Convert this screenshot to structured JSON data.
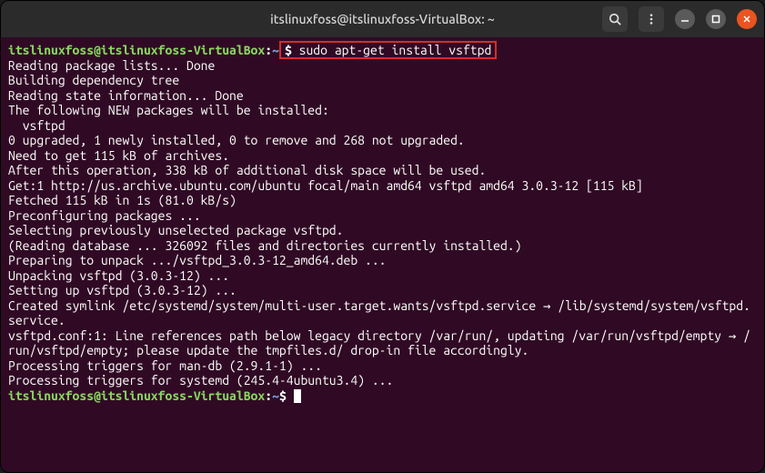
{
  "titlebar": {
    "title": "itslinuxfoss@itslinuxfoss-VirtualBox: ~"
  },
  "prompt": {
    "user_host": "itslinuxfoss@itslinuxfoss-VirtualBox",
    "colon": ":",
    "path": "~",
    "dollar": "$ "
  },
  "command": "sudo apt-get install vsftpd",
  "output": [
    "Reading package lists... Done",
    "Building dependency tree",
    "Reading state information... Done",
    "The following NEW packages will be installed:",
    "  vsftpd",
    "0 upgraded, 1 newly installed, 0 to remove and 268 not upgraded.",
    "Need to get 115 kB of archives.",
    "After this operation, 338 kB of additional disk space will be used.",
    "Get:1 http://us.archive.ubuntu.com/ubuntu focal/main amd64 vsftpd amd64 3.0.3-12 [115 kB]",
    "Fetched 115 kB in 1s (81.0 kB/s)",
    "Preconfiguring packages ...",
    "Selecting previously unselected package vsftpd.",
    "(Reading database ... 326092 files and directories currently installed.)",
    "Preparing to unpack .../vsftpd_3.0.3-12_amd64.deb ...",
    "Unpacking vsftpd (3.0.3-12) ...",
    "Setting up vsftpd (3.0.3-12) ...",
    "Created symlink /etc/systemd/system/multi-user.target.wants/vsftpd.service → /lib/systemd/system/vsftpd.service.",
    "vsftpd.conf:1: Line references path below legacy directory /var/run/, updating /var/run/vsftpd/empty → /run/vsftpd/empty; please update the tmpfiles.d/ drop-in file accordingly.",
    "Processing triggers for man-db (2.9.1-1) ...",
    "Processing triggers for systemd (245.4-4ubuntu3.4) ..."
  ]
}
